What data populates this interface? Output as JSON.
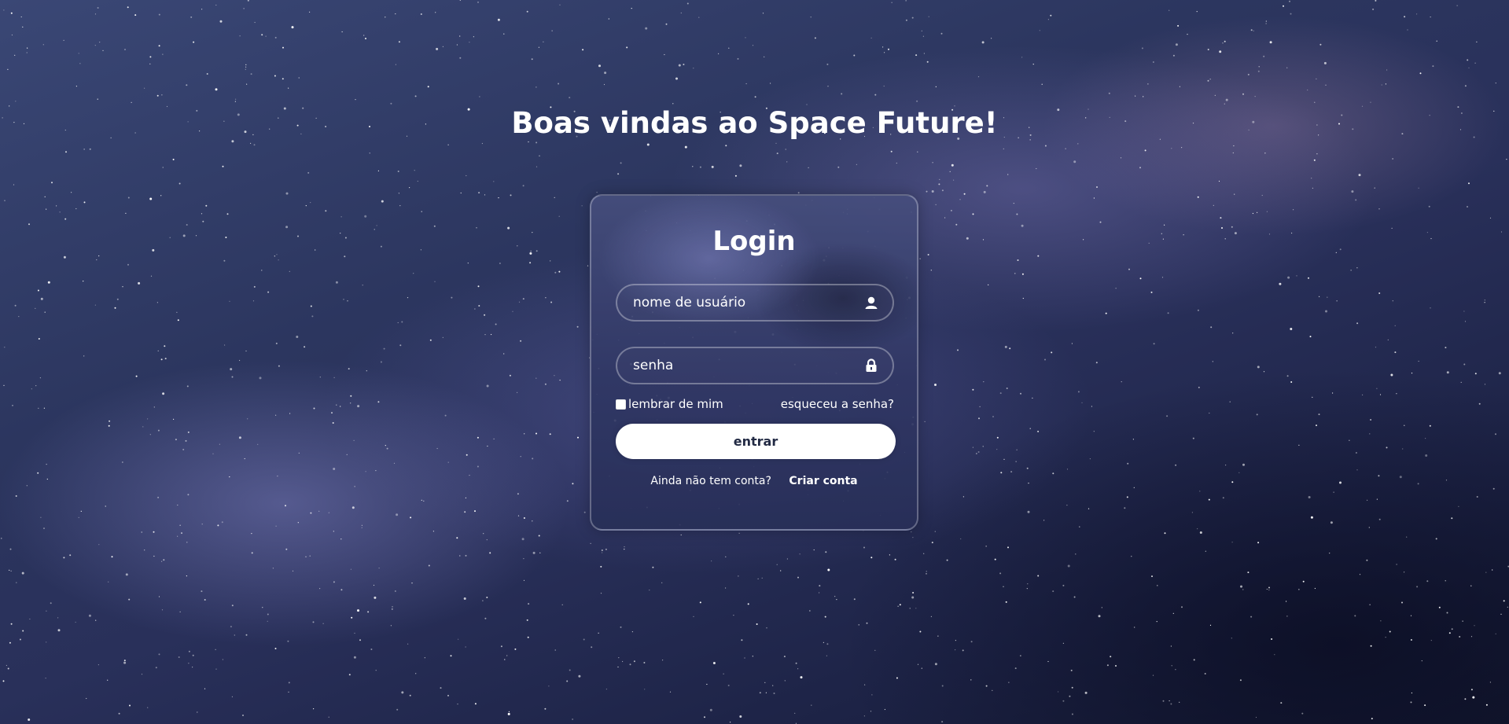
{
  "page": {
    "heading": "Boas vindas ao Space Future!"
  },
  "login": {
    "title": "Login",
    "username_placeholder": "nome de usuário",
    "username_value": "",
    "password_placeholder": "senha",
    "password_value": "",
    "username_icon": "user-icon",
    "password_icon": "lock-icon",
    "remember_label": "lembrar de mim",
    "remember_checked": false,
    "forgot_label": "esqueceu a senha?",
    "submit_label": "entrar",
    "no_account_text": "Ainda não tem conta?",
    "create_account_label": "Criar conta"
  },
  "colors": {
    "button_bg": "#ffffff",
    "button_text": "#222a44",
    "text": "#ffffff"
  }
}
